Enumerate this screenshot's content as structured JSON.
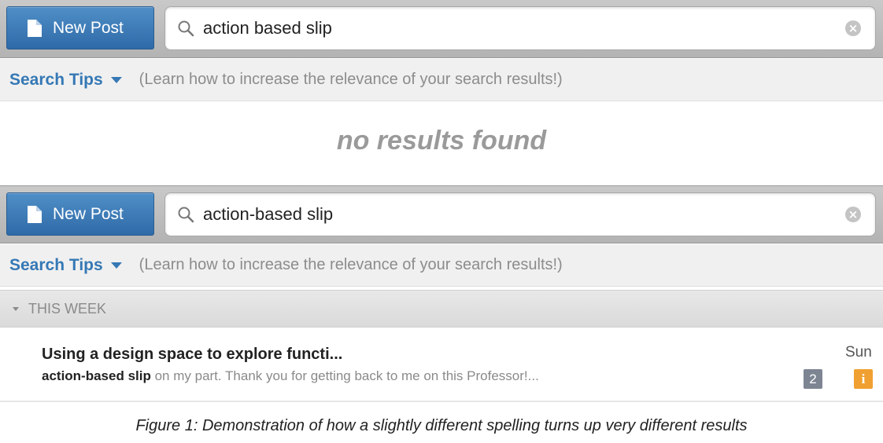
{
  "screens": [
    {
      "new_post_label": "New Post",
      "search_value": "action based slip",
      "search_tips_label": "Search Tips",
      "search_tips_description": "(Learn how to increase the relevance of your search results!)",
      "empty_message": "no results found"
    },
    {
      "new_post_label": "New Post",
      "search_value": "action-based slip",
      "search_tips_label": "Search Tips",
      "search_tips_description": "(Learn how to increase the relevance of your search results!)",
      "group_header": "THIS WEEK",
      "results": [
        {
          "title": "Using a design space to explore functi...",
          "snippet_highlight": "action-based slip",
          "snippet_rest": " on my part. Thank you for getting back to me on this Professor!...",
          "date": "Sun",
          "count_badge": "2",
          "info_badge": "i"
        }
      ]
    }
  ],
  "caption": "Figure 1: Demonstration of how a slightly different spelling turns up very different results",
  "colors": {
    "accent_blue": "#3578b5",
    "button_blue": "#2f6aa8",
    "badge_gray": "#7d8593",
    "badge_orange": "#f0a030"
  },
  "icons": [
    "document-icon",
    "search-icon",
    "clear-icon",
    "caret-down-icon",
    "triangle-down-icon"
  ]
}
